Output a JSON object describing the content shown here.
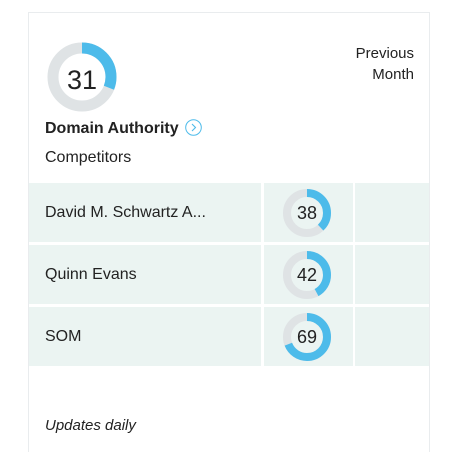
{
  "widget": {
    "score": "31",
    "score_fraction": 0.31,
    "title": "Domain Authority",
    "column_header": "Previous Month",
    "competitors_label": "Competitors",
    "footer": "Updates daily",
    "info_icon": "circle-chevron-right-icon",
    "colors": {
      "accent": "#4dbbea",
      "track": "#dfe3e5",
      "row_bg": "#ebf4f2"
    }
  },
  "competitors": [
    {
      "name": "David M. Schwartz A...",
      "score": "38",
      "fraction": 0.38
    },
    {
      "name": "Quinn Evans",
      "score": "42",
      "fraction": 0.42
    },
    {
      "name": "SOM",
      "score": "69",
      "fraction": 0.69
    }
  ]
}
